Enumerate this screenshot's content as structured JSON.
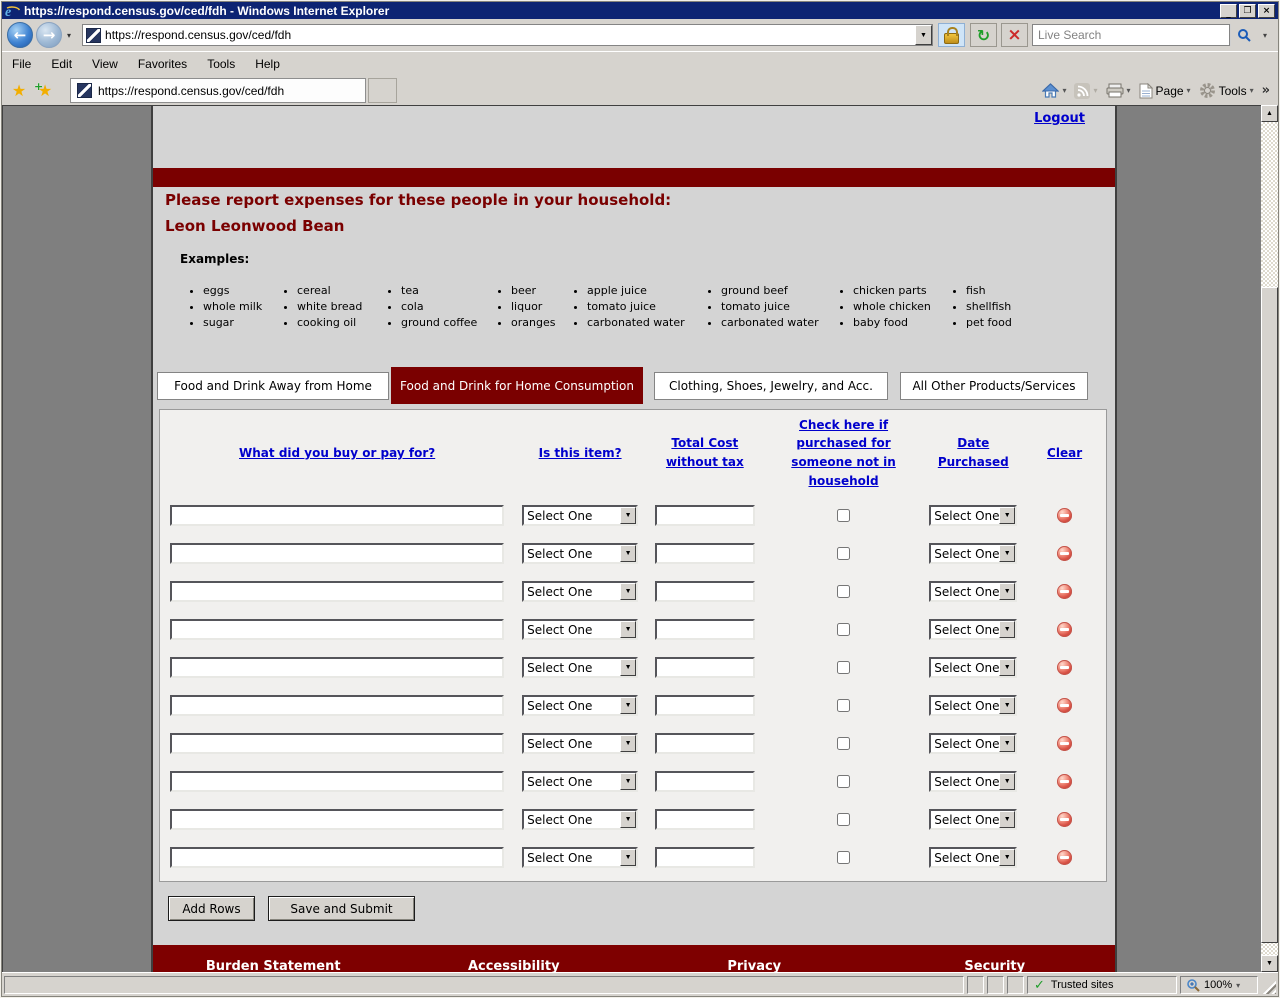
{
  "window": {
    "title": "https://respond.census.gov/ced/fdh - Windows Internet Explorer"
  },
  "toolbar": {
    "url": "https://respond.census.gov/ced/fdh",
    "search_placeholder": "Live Search"
  },
  "menu": {
    "items": [
      "File",
      "Edit",
      "View",
      "Favorites",
      "Tools",
      "Help"
    ]
  },
  "favorites_bar": {
    "tab_title": "https://respond.census.gov/ced/fdh",
    "page_label": "Page",
    "tools_label": "Tools"
  },
  "icons": {
    "back_arrow": "←",
    "forward_arrow": "→",
    "dropdown_arrow": "▼",
    "small_dropdown": "▾",
    "refresh": "↻",
    "stop": "×",
    "minimize": "_",
    "restore": "❐",
    "close": "×",
    "favorites_star": "★",
    "add_favorite_plus": "+",
    "chevron_right": "»",
    "scroll_up": "▲",
    "scroll_down": "▼",
    "check": "✓",
    "home": "css-house-shape",
    "rss": "css-rss-shape",
    "printer": "css-printer-shape",
    "page": "css-page-shape",
    "gear": "css-gear-shape",
    "magnifier": "css-magnifier-shape",
    "lock": "css-padlock-shape",
    "clear_row": "red-minus-circle"
  },
  "colors": {
    "title_bar": "#0d2473",
    "chrome_gray": "#d6d3ce",
    "maroon": "#7a0000",
    "content_bg": "#d4d4d4",
    "viewport_margin": "#7f7f7f",
    "link_blue": "#0000cc",
    "table_bg": "#f1f0ee"
  },
  "page": {
    "logout_label": "Logout",
    "heading_line1": "Please report expenses for these people in your household:",
    "heading_line2": "Leon Leonwood Bean",
    "examples_label": "Examples:",
    "example_columns": [
      [
        "eggs",
        "whole milk",
        "sugar"
      ],
      [
        "cereal",
        "white bread",
        "cooking oil"
      ],
      [
        "tea",
        "cola",
        "ground coffee"
      ],
      [
        "beer",
        "liquor",
        "oranges"
      ],
      [
        "apple juice",
        "tomato juice",
        "carbonated water"
      ],
      [
        "ground beef",
        "tomato juice",
        "carbonated water"
      ],
      [
        "chicken parts",
        "whole chicken",
        "baby food"
      ],
      [
        "fish",
        "shellfish",
        "pet food"
      ]
    ],
    "tabs": [
      {
        "label": "Food and Drink Away from Home",
        "active": false
      },
      {
        "label": "Food and Drink for Home Consumption",
        "active": true
      },
      {
        "label": "Clothing, Shoes, Jewelry, and Acc.",
        "active": false
      },
      {
        "label": "All Other Products/Services",
        "active": false
      }
    ],
    "table": {
      "headers": {
        "item": "What did you buy or pay for?",
        "is_item": "Is this item?",
        "cost": "Total Cost without tax",
        "not_household": "Check here if purchased for someone not in household",
        "date": "Date Purchased",
        "clear": "Clear"
      },
      "rows": [
        {
          "item_value": "",
          "is_item": "Select One",
          "cost_value": "",
          "purchased_for_other": false,
          "date": "Select One"
        },
        {
          "item_value": "",
          "is_item": "Select One",
          "cost_value": "",
          "purchased_for_other": false,
          "date": "Select One"
        },
        {
          "item_value": "",
          "is_item": "Select One",
          "cost_value": "",
          "purchased_for_other": false,
          "date": "Select One"
        },
        {
          "item_value": "",
          "is_item": "Select One",
          "cost_value": "",
          "purchased_for_other": false,
          "date": "Select One"
        },
        {
          "item_value": "",
          "is_item": "Select One",
          "cost_value": "",
          "purchased_for_other": false,
          "date": "Select One"
        },
        {
          "item_value": "",
          "is_item": "Select One",
          "cost_value": "",
          "purchased_for_other": false,
          "date": "Select One"
        },
        {
          "item_value": "",
          "is_item": "Select One",
          "cost_value": "",
          "purchased_for_other": false,
          "date": "Select One"
        },
        {
          "item_value": "",
          "is_item": "Select One",
          "cost_value": "",
          "purchased_for_other": false,
          "date": "Select One"
        },
        {
          "item_value": "",
          "is_item": "Select One",
          "cost_value": "",
          "purchased_for_other": false,
          "date": "Select One"
        },
        {
          "item_value": "",
          "is_item": "Select One",
          "cost_value": "",
          "purchased_for_other": false,
          "date": "Select One"
        }
      ]
    },
    "buttons": {
      "add_rows": "Add Rows",
      "save_submit": "Save and Submit"
    },
    "footer": {
      "links": [
        "Burden Statement",
        "Accessibility",
        "Privacy",
        "Security"
      ]
    }
  },
  "status_bar": {
    "zone": "Trusted sites",
    "zoom": "100%"
  }
}
